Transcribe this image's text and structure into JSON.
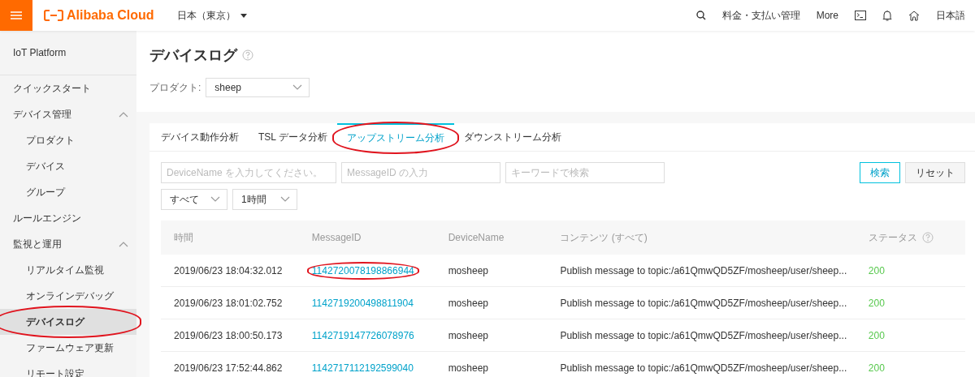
{
  "topbar": {
    "brand": "Alibaba Cloud",
    "region": "日本（東京）",
    "links": [
      {
        "kind": "search"
      },
      {
        "kind": "text",
        "label": "料金・支払い管理"
      },
      {
        "kind": "text",
        "label": "More"
      },
      {
        "kind": "terminal"
      },
      {
        "kind": "bell"
      },
      {
        "kind": "home"
      },
      {
        "kind": "text",
        "label": "日本語"
      }
    ]
  },
  "sidebar": {
    "title": "IoT Platform",
    "items": [
      {
        "label": "クイックスタート",
        "selected": false,
        "circled": false
      },
      {
        "label": "デバイス管理",
        "expanded": true,
        "selected": false,
        "circled": false,
        "children": [
          {
            "label": "プロダクト",
            "selected": false,
            "circled": false
          },
          {
            "label": "デバイス",
            "selected": false,
            "circled": false
          },
          {
            "label": "グループ",
            "selected": false,
            "circled": false
          }
        ]
      },
      {
        "label": "ルールエンジン",
        "selected": false,
        "circled": false
      },
      {
        "label": "監視と運用",
        "expanded": true,
        "selected": false,
        "circled": false,
        "children": [
          {
            "label": "リアルタイム監視",
            "selected": false,
            "circled": false
          },
          {
            "label": "オンラインデバッグ",
            "selected": false,
            "circled": false
          },
          {
            "label": "デバイスログ",
            "selected": true,
            "circled": true
          },
          {
            "label": "ファームウェア更新",
            "selected": false,
            "circled": false
          },
          {
            "label": "リモート設定",
            "selected": false,
            "circled": false
          }
        ]
      }
    ]
  },
  "page": {
    "title": "デバイスログ",
    "product_label": "プロダクト:",
    "product_value": "sheep"
  },
  "tabs": [
    {
      "label": "デバイス動作分析",
      "selected": false,
      "circled": false
    },
    {
      "label": "TSL データ分析",
      "selected": false,
      "circled": false
    },
    {
      "label": "アップストリーム分析",
      "selected": true,
      "circled": true
    },
    {
      "label": "ダウンストリーム分析",
      "selected": false,
      "circled": false
    }
  ],
  "filters": {
    "fields": [
      {
        "placeholder": "DeviceName を入力してください。"
      },
      {
        "placeholder": "MessageID の入力"
      },
      {
        "placeholder": "キーワードで検索"
      }
    ],
    "selects": [
      "すべて",
      "1時間"
    ],
    "buttons": [
      {
        "label": "検索",
        "kind": "primary"
      },
      {
        "label": "リセット",
        "kind": "normal"
      }
    ]
  },
  "table": {
    "columns": [
      {
        "label": "時間",
        "help": false
      },
      {
        "label": "MessageID",
        "help": false
      },
      {
        "label": "DeviceName",
        "help": false
      },
      {
        "label": "コンテンツ (すべて)",
        "help": false
      },
      {
        "label": "ステータス",
        "help": true
      }
    ],
    "rows": [
      {
        "time": "2019/06/23 18:04:32.012",
        "message_id": "1142720078198866944",
        "circled": true,
        "device": "mosheep",
        "content": "Publish message to topic:/a61QmwQD5ZF/mosheep/user/sheep...",
        "status": "200"
      },
      {
        "time": "2019/06/23 18:01:02.752",
        "message_id": "1142719200498811904",
        "circled": false,
        "device": "mosheep",
        "content": "Publish message to topic:/a61QmwQD5ZF/mosheep/user/sheep...",
        "status": "200"
      },
      {
        "time": "2019/06/23 18:00:50.173",
        "message_id": "1142719147726078976",
        "circled": false,
        "device": "mosheep",
        "content": "Publish message to topic:/a61QmwQD5ZF/mosheep/user/sheep...",
        "status": "200"
      },
      {
        "time": "2019/06/23 17:52:44.862",
        "message_id": "1142717112192599040",
        "circled": false,
        "device": "mosheep",
        "content": "Publish message to topic:/a61QmwQD5ZF/mosheep/user/sheep...",
        "status": "200"
      }
    ]
  }
}
